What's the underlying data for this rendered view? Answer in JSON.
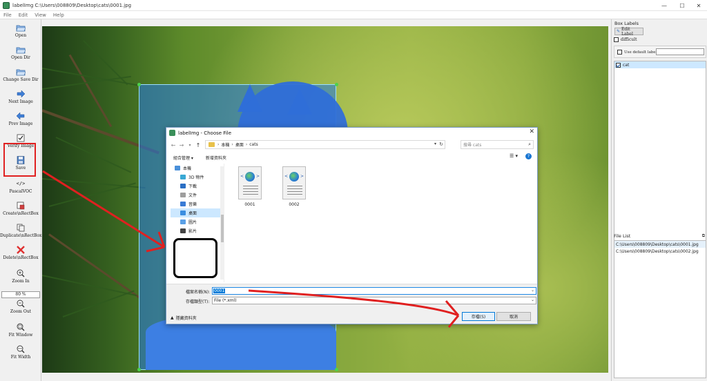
{
  "window": {
    "title": "labelImg C:\\Users\\008809\\Desktop\\cats\\0001.jpg",
    "controls": [
      "—",
      "☐",
      "✕"
    ]
  },
  "menu": [
    "File",
    "Edit",
    "View",
    "Help"
  ],
  "toolbar": {
    "items": [
      {
        "label": "Open",
        "icon": "folder-open-icon"
      },
      {
        "label": "Open Dir",
        "icon": "folder-open-icon"
      },
      {
        "label": "Change Save Dir",
        "icon": "folder-open-icon"
      },
      {
        "label": "Next Image",
        "icon": "arrow-right-icon"
      },
      {
        "label": "Prev Image",
        "icon": "arrow-left-icon"
      },
      {
        "label": "Verify Image",
        "icon": "check-icon"
      },
      {
        "label": "Save",
        "icon": "floppy-disk-icon"
      },
      {
        "label": "PascalVOC",
        "icon": "code-icon"
      },
      {
        "label": "Create\\nRectBox",
        "icon": "create-rect-icon"
      },
      {
        "label": "Duplicate\\nRectBox",
        "icon": "duplicate-icon"
      },
      {
        "label": "Delete\\nRectBox",
        "icon": "delete-x-icon"
      },
      {
        "label": "Zoom In",
        "icon": "zoom-in-icon"
      },
      {
        "label": "Zoom Out",
        "icon": "zoom-out-icon"
      },
      {
        "label": "Fit Window",
        "icon": "fit-window-icon"
      },
      {
        "label": "Fit Width",
        "icon": "fit-width-icon"
      }
    ],
    "zoom_value": "80 %",
    "pascal_symbol": "</>",
    "accent_red": "#e02020"
  },
  "box_labels": {
    "title": "Box Labels",
    "edit_label": "Edit Label",
    "difficult": "difficult",
    "use_default_label": "Use default label",
    "labels": [
      {
        "name": "cat",
        "checked": true
      }
    ]
  },
  "file_list": {
    "title": "File List",
    "files": [
      "C:\\Users\\008809\\Desktop\\cats\\0001.jpg",
      "C:\\Users\\008809\\Desktop\\cats\\0002.jpg"
    ]
  },
  "dialog": {
    "title": "labelImg - Choose File",
    "close": "✕",
    "path": [
      "本機",
      "桌面",
      "cats"
    ],
    "search_placeholder": "搜尋 cats",
    "organize": "組合管理 ▾",
    "new_folder": "新增資料夾",
    "nav_items": [
      {
        "label": "本機",
        "color": "#4a90d9",
        "sub": false,
        "selected": false
      },
      {
        "label": "3D 物件",
        "color": "#39a8d4",
        "sub": true,
        "selected": false
      },
      {
        "label": "下載",
        "color": "#2a6fc4",
        "sub": true,
        "selected": false
      },
      {
        "label": "文件",
        "color": "#9e9e9e",
        "sub": true,
        "selected": false
      },
      {
        "label": "音樂",
        "color": "#3a7bd5",
        "sub": true,
        "selected": false
      },
      {
        "label": "桌面",
        "color": "#3b8ee0",
        "sub": true,
        "selected": true
      },
      {
        "label": "圖片",
        "color": "#5aa0e6",
        "sub": true,
        "selected": false
      },
      {
        "label": "影片",
        "color": "#444444",
        "sub": true,
        "selected": false
      }
    ],
    "files": [
      "0001",
      "0002"
    ],
    "filename_label": "檔案名稱(N):",
    "filename_value": "0001",
    "filetype_label": "存檔類型(T):",
    "filetype_value": "File (*.xml)",
    "hide_folders": "隱藏資料夾",
    "save_button": "存檔(S)",
    "cancel_button": "取消"
  }
}
